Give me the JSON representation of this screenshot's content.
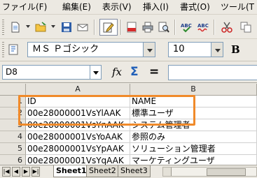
{
  "menu": [
    {
      "label": "ファイル(F)"
    },
    {
      "label": "編集(E)"
    },
    {
      "label": "表示(V)"
    },
    {
      "label": "挿入(I)"
    },
    {
      "label": "書式(O)"
    },
    {
      "label": "ツール(T"
    }
  ],
  "toolbar": {
    "pdf_label": "PDF",
    "spell_label": "ABC"
  },
  "format_toolbar": {
    "font_name": "ＭＳ Ｐゴシック",
    "font_size": "10",
    "bold_label": "B"
  },
  "formula_bar": {
    "cell_reference": "D8",
    "function_wizard_label": "fx",
    "sum_label": "Σ",
    "equals_label": "=",
    "formula_value": ""
  },
  "sheet": {
    "columns": [
      "A",
      "B"
    ],
    "row_numbers": [
      "1",
      "2",
      "3",
      "4",
      "5",
      "6"
    ],
    "rows": [
      [
        "ID",
        "NAME"
      ],
      [
        "00e28000001VsYlAAK",
        "標準ユーザ"
      ],
      [
        "00e28000001VsYnAAK",
        "システム管理者"
      ],
      [
        "00e28000001VsYoAAK",
        "参照のみ"
      ],
      [
        "00e28000001VsYpAAK",
        "ソリューション管理者"
      ],
      [
        "00e28000001VsYqAAK",
        "マーケティングユーザ"
      ]
    ]
  },
  "tabs": [
    {
      "label": "Sheet1",
      "active": true
    },
    {
      "label": "Sheet2",
      "active": false
    },
    {
      "label": "Sheet3",
      "active": false
    }
  ],
  "nav_buttons": [
    "|◀",
    "◀",
    "▶",
    "▶|"
  ],
  "colors": {
    "highlight": "#f08a2a",
    "accent_blue": "#1f5fb8"
  }
}
